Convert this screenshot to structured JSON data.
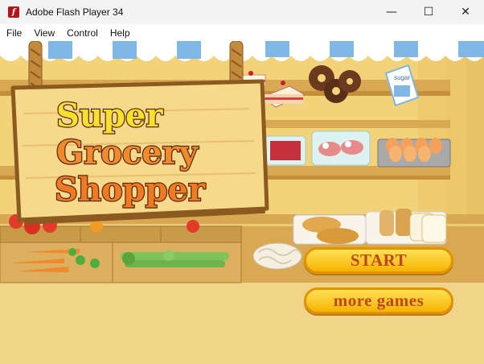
{
  "window": {
    "title": "Adobe Flash Player 34",
    "icon": "flash-player-icon",
    "minimize_glyph": "—",
    "maximize_glyph": "☐",
    "close_glyph": "✕"
  },
  "menu": {
    "items": [
      "File",
      "View",
      "Control",
      "Help"
    ]
  },
  "game": {
    "logo_line1": "Super",
    "logo_line2": "Grocery",
    "logo_line3": "Shopper",
    "sugar_label": "sugar",
    "start_label": "START",
    "more_games_label": "more games",
    "colors": {
      "awning_blue": "#7fb8e6",
      "wall": "#f3d37a",
      "shelf": "#d9a852",
      "sign_wood": "#f7d98c",
      "button_fill": "#ffd21f",
      "button_text": "#c0471c"
    }
  }
}
